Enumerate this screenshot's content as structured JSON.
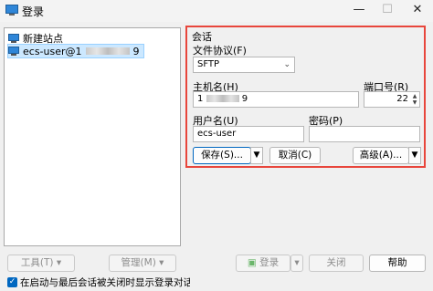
{
  "window": {
    "title": "登录",
    "minimize_glyph": "—",
    "maximize_glyph": "☐",
    "close_glyph": "✕"
  },
  "tree": {
    "items": [
      {
        "label": "新建站点",
        "icon": "computer-icon"
      },
      {
        "label_prefix": "ecs-user@1",
        "label_suffix": "9",
        "icon": "computer-icon",
        "selected": true
      }
    ]
  },
  "session": {
    "group_label": "会话",
    "protocol_label": "文件协议(F)",
    "protocol_value": "SFTP",
    "host_label": "主机名(H)",
    "host_prefix": "1",
    "host_suffix": "9",
    "port_label": "端口号(R)",
    "port_value": "22",
    "user_label": "用户名(U)",
    "user_value": "ecs-user",
    "password_label": "密码(P)",
    "password_value": "",
    "save_button": "保存(S)...",
    "cancel_button": "取消(C)",
    "advanced_button": "高级(A)..."
  },
  "bottom": {
    "tools_button": "工具(T)",
    "manage_button": "管理(M)",
    "login_button": "登录",
    "close_button": "关闭",
    "help_button": "帮助",
    "checkbox_label": "在启动与最后会话被关闭时显示登录对话框(S",
    "checkbox_checked": true
  },
  "colors": {
    "highlight_border": "#e8463c",
    "selection": "#cce8ff",
    "accent": "#0067c0"
  }
}
